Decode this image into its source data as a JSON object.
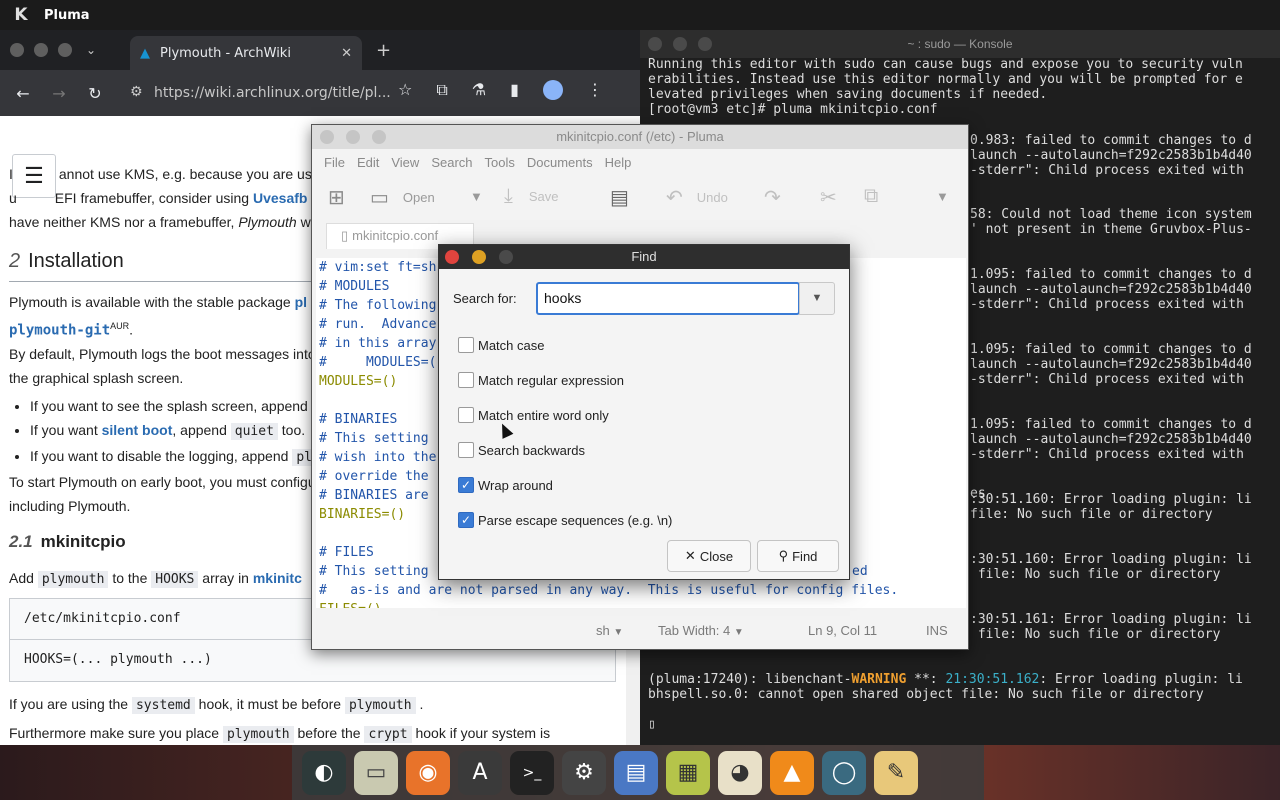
{
  "top_panel": {
    "app_name": "Pluma"
  },
  "chrome": {
    "tab_title": "Plymouth - ArchWiki",
    "url": "https://wiki.archlinux.org/title/pl...",
    "page": {
      "intro_line1_a": "I",
      "intro_line1_b": "annot use KMS, e.g. because you are usi",
      "intro_line2_a": "u",
      "intro_line2_b": "EFI framebuffer, consider using",
      "intro_line2_link": "Uvesafb",
      "intro_line3_a": "have neither KMS nor a framebuffer,",
      "intro_line3_em": "Plymouth",
      "intro_line3_b": "w",
      "h2_num": "2",
      "h2_title": "Installation",
      "p1_a": "Plymouth is available with the stable package",
      "p1_link": "pl",
      "p1_pkg": "plymouth-git",
      "p1_aur": "AUR",
      "p1_dot": ".",
      "p2_line1": "By default, Plymouth logs the boot messages into",
      "p2_line2": "the graphical splash screen.",
      "li1": "If you want to see the splash screen, append",
      "li2_a": "If you want",
      "li2_link": "silent boot",
      "li2_b": ", append",
      "li2_code": "quiet",
      "li2_c": "too.",
      "li3_a": "If you want to disable the logging, append",
      "li3_code": "pl",
      "p3_line1": "To start Plymouth on early boot, you must configu",
      "p3_line2": "including Plymouth.",
      "h3_num": "2.1",
      "h3_title": "mkinitcpio",
      "p4_a": "Add",
      "p4_code1": "plymouth",
      "p4_b": "to the",
      "p4_code2": "HOOKS",
      "p4_c": "array in",
      "p4_link": "mkinitc",
      "code_header": "/etc/mkinitcpio.conf",
      "code_body": "HOOKS=(... plymouth ...)",
      "p5_a": "If you are using the",
      "p5_code1": "systemd",
      "p5_b": "hook, it must be before",
      "p5_code2": "plymouth",
      "p5_c": ".",
      "p6_a": "Furthermore make sure you place",
      "p6_code1": "plymouth",
      "p6_b": "before the",
      "p6_code2": "crypt",
      "p6_c": "hook if your system is"
    }
  },
  "konsole": {
    "title": "~ : sudo — Konsole",
    "lines": [
      "Running this editor with sudo can cause bugs and expose you to security vuln",
      "erabilities. Instead use this editor normally and you will be prompted for e",
      "levated privileges when saving documents if needed.",
      "[root@vm3 etc]# pluma mkinitcpio.conf",
      "0.983: failed to commit changes to d",
      "launch --autolaunch=f292c2583b1b4d40",
      "-stderr\": Child process exited with",
      "58: Could not load theme icon system",
      "' not present in theme Gruvbox-Plus-",
      "1.095: failed to commit changes to d",
      "launch --autolaunch=f292c2583b1b4d40",
      "-stderr\": Child process exited with",
      "1.095: failed to commit changes to d",
      "launch --autolaunch=f292c2583b1b4d40",
      "-stderr\": Child process exited with",
      "1.095: failed to commit changes to d",
      "launch --autolaunch=f292c2583b1b4d40",
      "-stderr\": Child process exited with",
      "es",
      ":30:51.160: Error loading plugin: li",
      "file: No such file or directory",
      ":30:51.160: Error loading plugin: li",
      " file: No such file or directory",
      ":30:51.161: Error loading plugin: li",
      " file: No such file or directory"
    ],
    "last_line_a": "(pluma:17240): libenchant-",
    "last_line_warn": "WARNING",
    "last_line_b": " **: ",
    "last_line_time": "21:30:51.162",
    "last_line_c": ": Error loading plugin: li",
    "last_line2": "bhspell.so.0: cannot open shared object file: No such file or directory",
    "cursor": "▯"
  },
  "pluma": {
    "title": "mkinitcpio.conf (/etc) - Pluma",
    "menu": [
      "File",
      "Edit",
      "View",
      "Search",
      "Tools",
      "Documents",
      "Help"
    ],
    "toolbar": {
      "open": "Open",
      "save": "Save",
      "undo": "Undo"
    },
    "doc_tab": "mkinitcpio.conf",
    "editor_lines": [
      "# vim:set ft=sh",
      "# MODULES",
      "# The following",
      "# run.  Advance",
      "# in this array",
      "#     MODULES=(",
      "MODULES=()",
      "",
      "# BINARIES",
      "# This setting",
      "# wish into the",
      "# override the",
      "# BINARIES are",
      "BINARIES=()",
      "",
      "# FILES",
      "# This setting",
      "#   as-is and are not parsed in any way.  This is useful for config files.",
      "FILES=()"
    ],
    "editor_fragment_ed": "ed",
    "status": {
      "lang": "sh",
      "tab_width": "Tab Width:  4",
      "position": "Ln 9, Col 11",
      "mode": "INS"
    }
  },
  "find": {
    "title": "Find",
    "search_label": "Search for:",
    "search_value": "hooks",
    "options": [
      {
        "label": "Match case",
        "checked": false
      },
      {
        "label": "Match regular expression",
        "checked": false
      },
      {
        "label": "Match entire word only",
        "checked": false
      },
      {
        "label": "Search backwards",
        "checked": false
      },
      {
        "label": "Wrap around",
        "checked": true
      },
      {
        "label": "Parse escape sequences (e.g. \\n)",
        "checked": true
      }
    ],
    "close_label": "Close",
    "find_label": "Find"
  },
  "dock": {
    "items": [
      "budgie-icon",
      "files-icon",
      "firefox-icon",
      "font-viewer-icon",
      "terminal-icon",
      "settings-icon",
      "document-viewer-icon",
      "spreadsheet-icon",
      "gimp-icon",
      "vlc-icon",
      "screenshot-icon",
      "text-editor-icon"
    ]
  },
  "colors": {
    "accent": "#3a7bd5",
    "link": "#2a6bb1",
    "warning": "#f0a030"
  }
}
